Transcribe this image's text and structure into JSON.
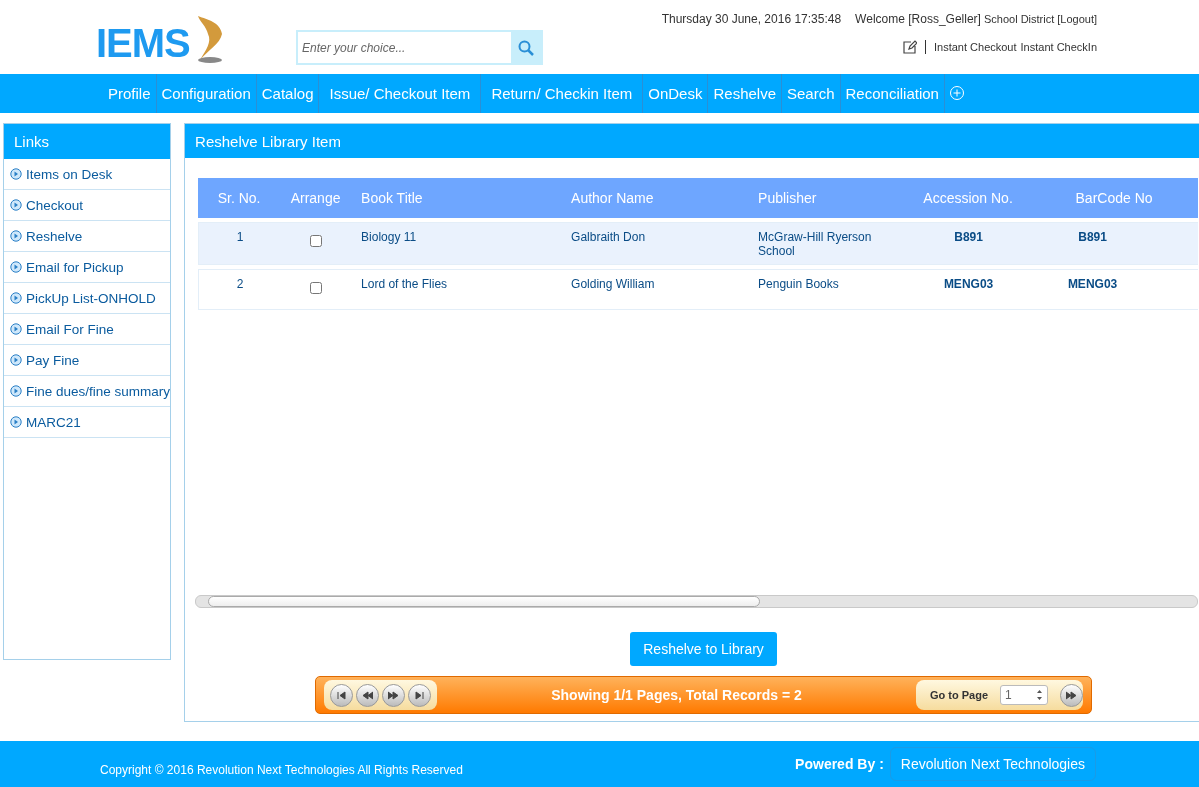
{
  "header": {
    "logo_text": "IEMS",
    "search": {
      "placeholder": "Enter your choice..."
    },
    "datetime": "Thursday 30 June, 2016 17:35:48",
    "welcome": "Welcome [Ross_Geller]",
    "district": "School District",
    "logout": "[Logout]",
    "quick_links": [
      "Instant Checkout",
      "Instant CheckIn"
    ]
  },
  "nav": [
    "Profile",
    "Configuration",
    "Catalog",
    "Issue/ Checkout Item",
    "Return/ Checkin Item",
    "OnDesk",
    "Reshelve",
    "Search",
    "Reconciliation"
  ],
  "sidebar": {
    "title": "Links",
    "items": [
      "Items on Desk",
      "Checkout",
      "Reshelve",
      "Email for Pickup",
      "PickUp List-ONHOLD",
      "Email For Fine",
      "Pay Fine",
      "Fine dues/fine summary",
      "MARC21"
    ]
  },
  "panel": {
    "title": "Reshelve Library Item",
    "table": {
      "columns": [
        "Sr. No.",
        "Arrange",
        "Book Title",
        "Author Name",
        "Publisher",
        "Accession No.",
        "BarCode No"
      ],
      "rows": [
        {
          "sr": "1",
          "checked": false,
          "title": "Biology 11",
          "author": "Galbraith Don",
          "publisher": "McGraw-Hill Ryerson School",
          "accession": "B891",
          "barcode": "B891"
        },
        {
          "sr": "2",
          "checked": false,
          "title": "Lord of the Flies",
          "author": "Golding William",
          "publisher": "Penguin Books",
          "accession": "MENG03",
          "barcode": "MENG03"
        }
      ]
    },
    "action_button": "Reshelve to Library",
    "pager": {
      "summary": "Showing 1/1  Pages, Total Records = 2",
      "goto_label": "Go to Page",
      "page": "1"
    }
  },
  "footer": {
    "copyright": "Copyright © 2016 Revolution Next Technologies All Rights Reserved",
    "powered_label": "Powered By :",
    "powered_by": "Revolution Next Technologies"
  }
}
